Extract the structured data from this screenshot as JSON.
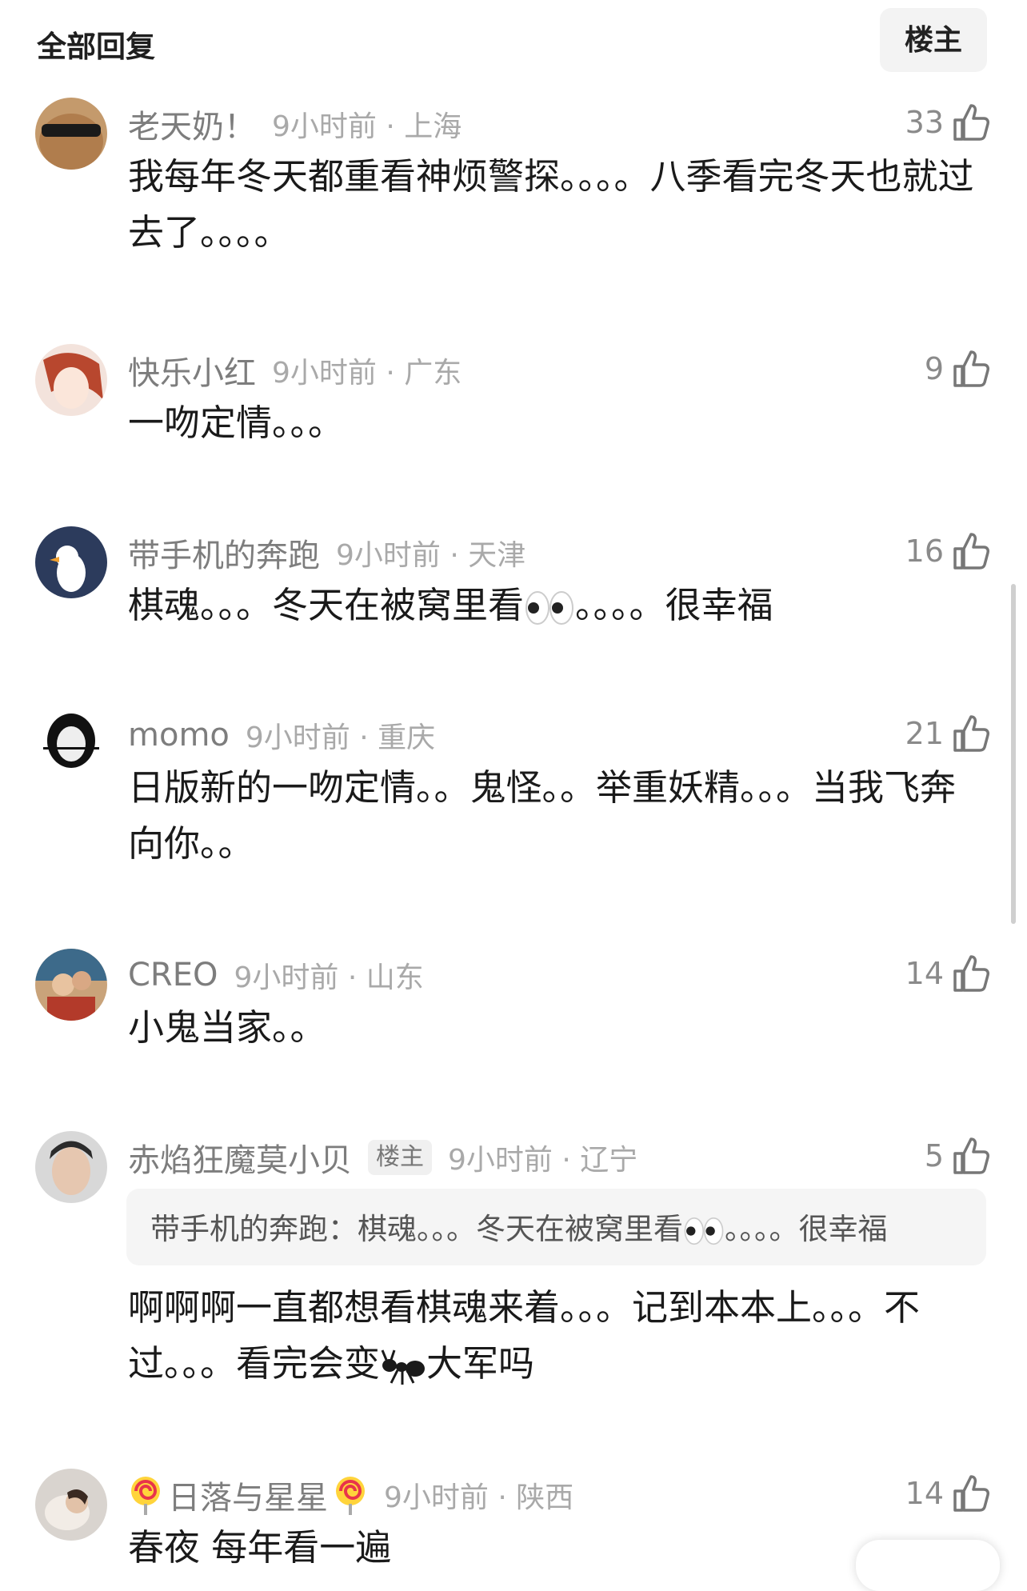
{
  "header": {
    "title": "全部回复",
    "op_button": "楼主"
  },
  "comments": [
    {
      "user": "老天奶！",
      "time": "9小时前 · 上海",
      "likes": "33",
      "text": "我每年冬天都重看神烦警探。。。。八季看完冬天也就过去了。。。。"
    },
    {
      "user": "快乐小红",
      "time": "9小时前 · 广东",
      "likes": "9",
      "text": "一吻定情。。。"
    },
    {
      "user": "带手机的奔跑",
      "time": "9小时前 · 天津",
      "likes": "16",
      "text_a": "棋魂。。。冬天在被窝里看",
      "text_b": "。。。。很幸福"
    },
    {
      "user": "momo",
      "time": "9小时前 · 重庆",
      "likes": "21",
      "text": "日版新的一吻定情。。鬼怪。。举重妖精。。。当我飞奔向你。。"
    },
    {
      "user": "CREO",
      "time": "9小时前 · 山东",
      "likes": "14",
      "text": "小鬼当家。。"
    },
    {
      "user": "赤焰狂魔莫小贝",
      "tag": "楼主",
      "time": "9小时前 · 辽宁",
      "likes": "5",
      "quote_a": "带手机的奔跑：棋魂。。。冬天在被窝里看",
      "quote_b": "。。。。很幸福",
      "text_a": "啊啊啊一直都想看棋魂来着。。。记到本本上。。。不过。。。看完会变",
      "text_b": "大军吗"
    },
    {
      "user": "日落与星星",
      "time": "9小时前 · 陕西",
      "likes": "14",
      "text": "春夜 每年看一遍"
    }
  ]
}
